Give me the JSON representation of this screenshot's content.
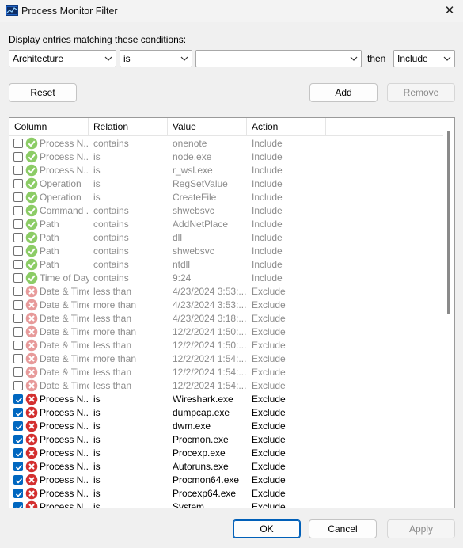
{
  "window": {
    "title": "Process Monitor Filter",
    "close_glyph": "✕"
  },
  "conditions": {
    "label": "Display entries matching these conditions:",
    "column_value": "Architecture",
    "relation_value": "is",
    "value_value": "",
    "then_label": "then",
    "action_value": "Include"
  },
  "buttons": {
    "reset": "Reset",
    "add": "Add",
    "remove": "Remove",
    "ok": "OK",
    "cancel": "Cancel",
    "apply": "Apply"
  },
  "list": {
    "headers": {
      "column": "Column",
      "relation": "Relation",
      "value": "Value",
      "action": "Action"
    },
    "rows": [
      {
        "checked": false,
        "action_type": "include",
        "column": "Process N...",
        "relation": "contains",
        "value": "onenote",
        "action": "Include"
      },
      {
        "checked": false,
        "action_type": "include",
        "column": "Process N...",
        "relation": "is",
        "value": "node.exe",
        "action": "Include"
      },
      {
        "checked": false,
        "action_type": "include",
        "column": "Process N...",
        "relation": "is",
        "value": "r_wsl.exe",
        "action": "Include"
      },
      {
        "checked": false,
        "action_type": "include",
        "column": "Operation",
        "relation": "is",
        "value": "RegSetValue",
        "action": "Include"
      },
      {
        "checked": false,
        "action_type": "include",
        "column": "Operation",
        "relation": "is",
        "value": "CreateFile",
        "action": "Include"
      },
      {
        "checked": false,
        "action_type": "include",
        "column": "Command ...",
        "relation": "contains",
        "value": "shwebsvc",
        "action": "Include"
      },
      {
        "checked": false,
        "action_type": "include",
        "column": "Path",
        "relation": "contains",
        "value": "AddNetPlace",
        "action": "Include"
      },
      {
        "checked": false,
        "action_type": "include",
        "column": "Path",
        "relation": "contains",
        "value": "dll",
        "action": "Include"
      },
      {
        "checked": false,
        "action_type": "include",
        "column": "Path",
        "relation": "contains",
        "value": "shwebsvc",
        "action": "Include"
      },
      {
        "checked": false,
        "action_type": "include",
        "column": "Path",
        "relation": "contains",
        "value": "ntdll",
        "action": "Include"
      },
      {
        "checked": false,
        "action_type": "include",
        "column": "Time of Day",
        "relation": "contains",
        "value": "9:24",
        "action": "Include"
      },
      {
        "checked": false,
        "action_type": "exclude",
        "column": "Date & Time",
        "relation": "less than",
        "value": "4/23/2024 3:53:...",
        "action": "Exclude"
      },
      {
        "checked": false,
        "action_type": "exclude",
        "column": "Date & Time",
        "relation": "more than",
        "value": "4/23/2024 3:53:...",
        "action": "Exclude"
      },
      {
        "checked": false,
        "action_type": "exclude",
        "column": "Date & Time",
        "relation": "less than",
        "value": "4/23/2024 3:18:...",
        "action": "Exclude"
      },
      {
        "checked": false,
        "action_type": "exclude",
        "column": "Date & Time",
        "relation": "more than",
        "value": "12/2/2024 1:50:...",
        "action": "Exclude"
      },
      {
        "checked": false,
        "action_type": "exclude",
        "column": "Date & Time",
        "relation": "less than",
        "value": "12/2/2024 1:50:...",
        "action": "Exclude"
      },
      {
        "checked": false,
        "action_type": "exclude",
        "column": "Date & Time",
        "relation": "more than",
        "value": "12/2/2024 1:54:...",
        "action": "Exclude"
      },
      {
        "checked": false,
        "action_type": "exclude",
        "column": "Date & Time",
        "relation": "less than",
        "value": "12/2/2024 1:54:...",
        "action": "Exclude"
      },
      {
        "checked": false,
        "action_type": "exclude",
        "column": "Date & Time",
        "relation": "less than",
        "value": "12/2/2024 1:54:...",
        "action": "Exclude"
      },
      {
        "checked": true,
        "action_type": "exclude",
        "column": "Process N...",
        "relation": "is",
        "value": "Wireshark.exe",
        "action": "Exclude"
      },
      {
        "checked": true,
        "action_type": "exclude",
        "column": "Process N...",
        "relation": "is",
        "value": "dumpcap.exe",
        "action": "Exclude"
      },
      {
        "checked": true,
        "action_type": "exclude",
        "column": "Process N...",
        "relation": "is",
        "value": "dwm.exe",
        "action": "Exclude"
      },
      {
        "checked": true,
        "action_type": "exclude",
        "column": "Process N...",
        "relation": "is",
        "value": "Procmon.exe",
        "action": "Exclude"
      },
      {
        "checked": true,
        "action_type": "exclude",
        "column": "Process N...",
        "relation": "is",
        "value": "Procexp.exe",
        "action": "Exclude"
      },
      {
        "checked": true,
        "action_type": "exclude",
        "column": "Process N...",
        "relation": "is",
        "value": "Autoruns.exe",
        "action": "Exclude"
      },
      {
        "checked": true,
        "action_type": "exclude",
        "column": "Process N...",
        "relation": "is",
        "value": "Procmon64.exe",
        "action": "Exclude"
      },
      {
        "checked": true,
        "action_type": "exclude",
        "column": "Process N...",
        "relation": "is",
        "value": "Procexp64.exe",
        "action": "Exclude"
      },
      {
        "checked": true,
        "action_type": "exclude",
        "column": "Process N...",
        "relation": "is",
        "value": "System",
        "action": "Exclude"
      }
    ]
  },
  "colors": {
    "accent": "#0067c0",
    "include_icon": "#8ccc66",
    "exclude_icon_enabled": "#d32f2f",
    "exclude_icon_disabled": "#e79a9a"
  }
}
